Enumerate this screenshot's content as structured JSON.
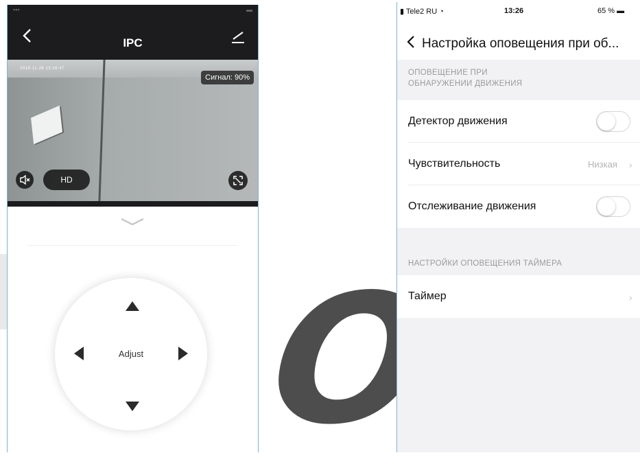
{
  "watermark": {
    "text": "OM"
  },
  "left_phone": {
    "nav": {
      "title": "IPC"
    },
    "video": {
      "timestamp": "2019-11-26 13:26:47",
      "signal": "Сигнал: 90%",
      "hd_label": "HD"
    },
    "ptz": {
      "center_label": "Adjust"
    }
  },
  "right_phone": {
    "status": {
      "carrier": "Tele2 RU",
      "time": "13:26",
      "battery": "65 %"
    },
    "nav": {
      "title": "Настройка оповещения при об..."
    },
    "section1": {
      "header_line1": "ОПОВЕЩЕНИЕ ПРИ",
      "header_line2": "ОБНАРУЖЕНИИ ДВИЖЕНИЯ"
    },
    "rows": {
      "motion_detector": {
        "label": "Детектор движения",
        "enabled": false
      },
      "sensitivity": {
        "label": "Чувствительность",
        "value": "Низкая"
      },
      "motion_tracking": {
        "label": "Отслеживание движения",
        "enabled": false
      }
    },
    "section2": {
      "header": "НАСТРОЙКИ ОПОВЕЩЕНИЯ ТАЙМЕРА"
    },
    "timer": {
      "label": "Таймер"
    }
  },
  "colors": {
    "nav_dark": "#1c1c1e",
    "frame_blue": "#7bb5d8",
    "group_bg": "#f2f2f4"
  }
}
